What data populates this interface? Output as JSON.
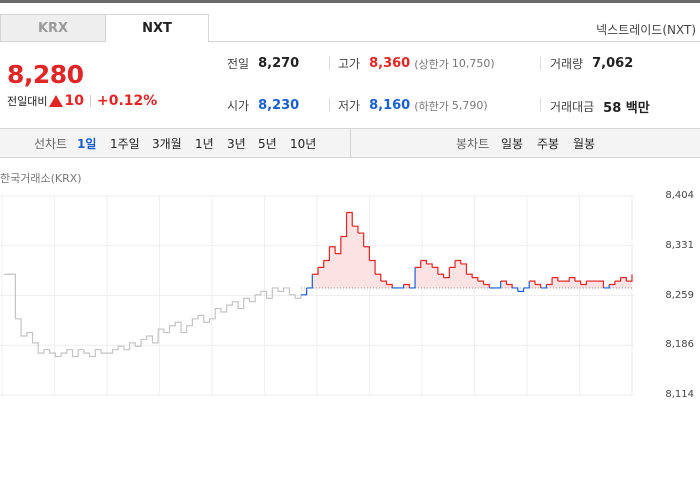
{
  "tabs": [
    "KRX",
    "NXT"
  ],
  "provider": "넥스트레이드(NXT)",
  "price": "8,280",
  "change": {
    "label": "전일대비",
    "value": "10",
    "percent": "+0.12%"
  },
  "stats": {
    "prev_close": {
      "label": "전일",
      "value": "8,270"
    },
    "high": {
      "label": "고가",
      "value": "8,360",
      "limit_label": "(상한가",
      "limit_value": "10,750)"
    },
    "volume": {
      "label": "거래량",
      "value": "7,062"
    },
    "open": {
      "label": "시가",
      "value": "8,230"
    },
    "low": {
      "label": "저가",
      "value": "8,160",
      "limit_label": "(하한가",
      "limit_value": "5,790)"
    },
    "amount": {
      "label": "거래대금",
      "value": "58 백만"
    }
  },
  "toolbar": {
    "line_label": "선차트",
    "periods": [
      "1일",
      "1주일",
      "3개월",
      "1년",
      "3년",
      "5년",
      "10년"
    ],
    "active_period": "1일",
    "candle_label": "봉차트",
    "candles": [
      "일봉",
      "주봉",
      "월봉"
    ]
  },
  "exchange_label": "한국거래소(KRX)",
  "colors": {
    "up": "#e22626",
    "down": "#1a5fd0",
    "grey_line": "#c4c4c4"
  },
  "chart_data": {
    "type": "line",
    "ylim": [
      8114,
      8404
    ],
    "yticks": [
      "8,404",
      "8,331",
      "8,259",
      "8,186",
      "8,114"
    ],
    "baseline": 8270,
    "series": [
      {
        "values": [
          8290,
          8290,
          8225,
          8200,
          8205,
          8190,
          8175,
          8180,
          8175,
          8170,
          8175,
          8180,
          8170,
          8180,
          8175,
          8170,
          8180,
          8175,
          8175,
          8180,
          8185,
          8180,
          8190,
          8185,
          8195,
          8200,
          8190,
          8210,
          8205,
          8215,
          8220,
          8205,
          8215,
          8225,
          8230,
          8220,
          8225,
          8240,
          8235,
          8245,
          8250,
          8240,
          8255,
          8250,
          8260,
          8265,
          8255,
          8270,
          8265,
          8270,
          8260,
          8255,
          8260,
          8270,
          8290,
          8300,
          8310,
          8330,
          8320,
          8345,
          8380,
          8360,
          8350,
          8330,
          8310,
          8290,
          8280,
          8275,
          8270,
          8270,
          8275,
          8270,
          8300,
          8310,
          8305,
          8300,
          8290,
          8285,
          8300,
          8310,
          8305,
          8290,
          8285,
          8280,
          8275,
          8270,
          8270,
          8280,
          8275,
          8270,
          8265,
          8270,
          8280,
          8275,
          8270,
          8275,
          8285,
          8280,
          8280,
          8285,
          8280,
          8275,
          8280,
          8280,
          8280,
          8270,
          8275,
          8280,
          8285,
          8280,
          8290
        ]
      }
    ]
  }
}
